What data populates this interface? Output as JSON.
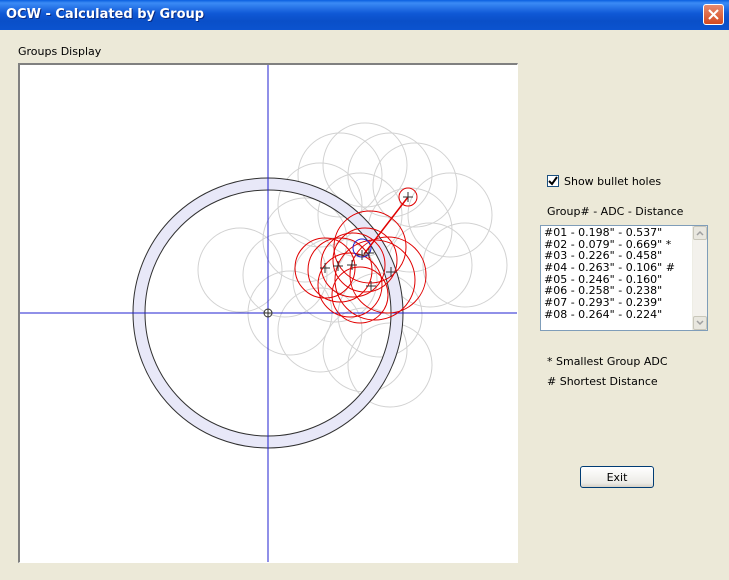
{
  "window": {
    "title": "OCW - Calculated by Group"
  },
  "groups_display": {
    "label": "Groups Display"
  },
  "options": {
    "show_bullet_holes_label": "Show bullet holes",
    "show_bullet_holes_checked": true
  },
  "groups_list": {
    "header": "Group# - ADC - Distance",
    "items": [
      "#01 - 0.198\" - 0.537\"",
      "#02 - 0.079\" - 0.669\" *",
      "#03 - 0.226\" - 0.458\"",
      "#04 - 0.263\" - 0.106\" #",
      "#05 - 0.246\" - 0.160\"",
      "#06 - 0.258\" - 0.238\"",
      "#07 - 0.293\" - 0.239\"",
      "#08 - 0.264\" - 0.224\""
    ]
  },
  "legend": {
    "smallest": "* Smallest Group ADC",
    "shortest": "# Shortest Distance"
  },
  "buttons": {
    "exit_label": "Exit"
  },
  "colors": {
    "crosshair": "#2020D0",
    "group_circle": "#E00000",
    "ghost_circle": "#D0D0D0",
    "target_ring_fill": "#E8E8F8",
    "titlebar": "#0A4FC8"
  }
}
